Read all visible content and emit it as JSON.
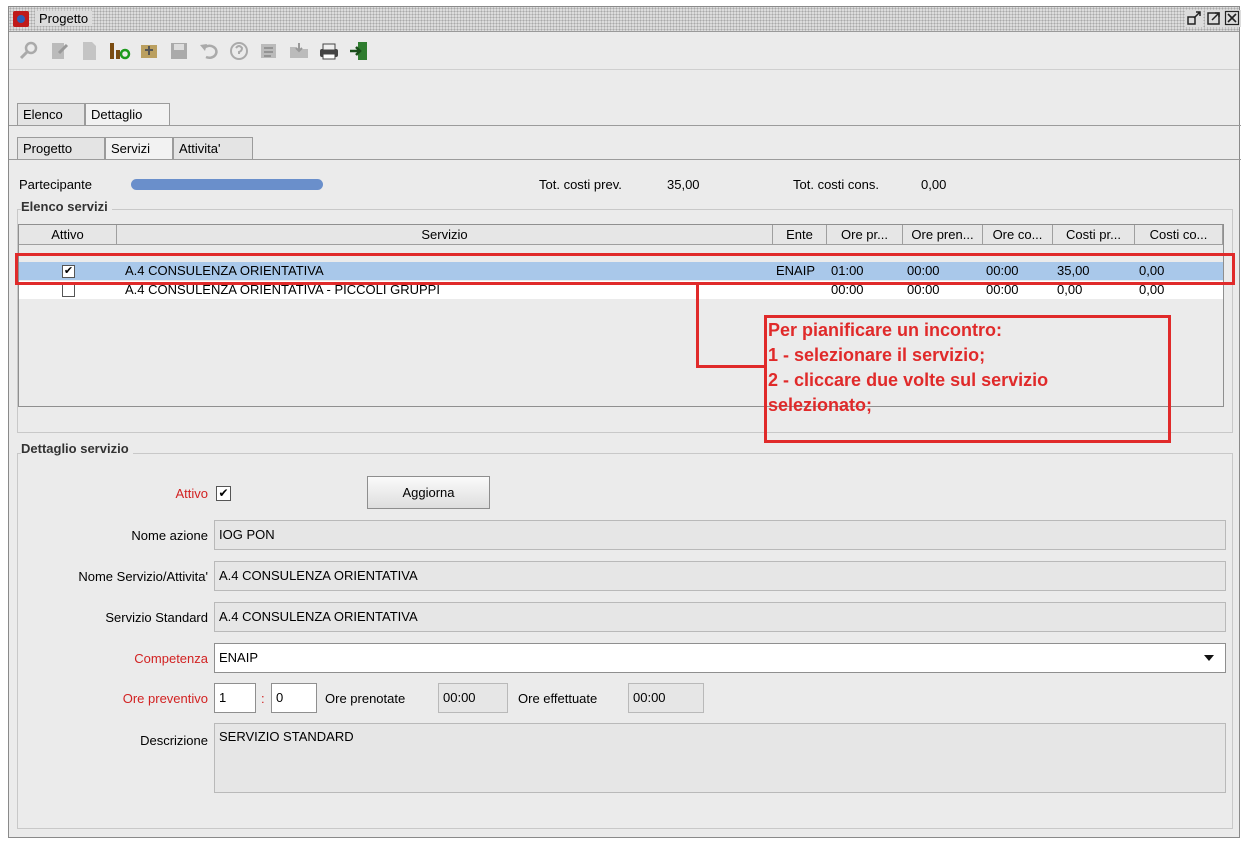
{
  "window": {
    "title": "Progetto",
    "controls": [
      "restore-icon",
      "maximize-icon",
      "close-icon"
    ]
  },
  "toolbar": {
    "icons": [
      "search-icon",
      "edit-icon",
      "new-document-icon",
      "info-icon",
      "export-icon",
      "save-icon",
      "undo-icon",
      "help-icon",
      "checklist-icon",
      "folder-icon",
      "print-icon",
      "exit-icon"
    ]
  },
  "tabs_main": [
    "Elenco",
    "Dettaglio"
  ],
  "tabs_sub": [
    "Progetto",
    "Servizi",
    "Attivita'"
  ],
  "summary": {
    "participant_label": "Partecipante",
    "tot_prev_label": "Tot. costi prev.",
    "tot_prev_value": "35,00",
    "tot_cons_label": "Tot. costi cons.",
    "tot_cons_value": "0,00"
  },
  "services_group": {
    "title": "Elenco servizi",
    "columns": [
      "Attivo",
      "Servizio",
      "Ente",
      "Ore pr...",
      "Ore pren...",
      "Ore co...",
      "Costi pr...",
      "Costi co..."
    ],
    "rows": [
      {
        "attivo": true,
        "servizio": "A.4 CONSULENZA ORIENTATIVA",
        "ente": "ENAIP",
        "ore_prev": "01:00",
        "ore_pren": "00:00",
        "ore_cons": "00:00",
        "costi_prev": "35,00",
        "costi_cons": "0,00"
      },
      {
        "attivo": false,
        "servizio": "A.4 CONSULENZA ORIENTATIVA - PICCOLI GRUPPI",
        "ente": "",
        "ore_prev": "00:00",
        "ore_pren": "00:00",
        "ore_cons": "00:00",
        "costi_prev": "0,00",
        "costi_cons": "0,00"
      }
    ]
  },
  "annotation": {
    "lines": [
      "Per pianificare un incontro:",
      "1 - selezionare il servizio;",
      "2 - cliccare due volte sul servizio",
      "selezionato;"
    ],
    "color": "#e02a2a"
  },
  "detail_group": {
    "title": "Dettaglio servizio",
    "attivo_label": "Attivo",
    "attivo_checked": true,
    "aggiorna_label": "Aggiorna",
    "nome_azione_label": "Nome azione",
    "nome_azione_value": "IOG PON",
    "nome_servizio_label": "Nome Servizio/Attivita'",
    "nome_servizio_value": "A.4 CONSULENZA ORIENTATIVA",
    "servizio_standard_label": "Servizio Standard",
    "servizio_standard_value": "A.4 CONSULENZA ORIENTATIVA",
    "competenza_label": "Competenza",
    "competenza_value": "ENAIP",
    "ore_preventivo_label": "Ore preventivo",
    "ore_preventivo_h": "1",
    "ore_preventivo_sep": ":",
    "ore_preventivo_m": "0",
    "ore_prenotate_label": "Ore prenotate",
    "ore_prenotate_value": "00:00",
    "ore_effettuate_label": "Ore effettuate",
    "ore_effettuate_value": "00:00",
    "descrizione_label": "Descrizione",
    "descrizione_value": "SERVIZIO STANDARD"
  },
  "colors": {
    "selected_row": "#a9c8ea",
    "required_label": "#d22222",
    "annotation": "#e02a2a"
  }
}
